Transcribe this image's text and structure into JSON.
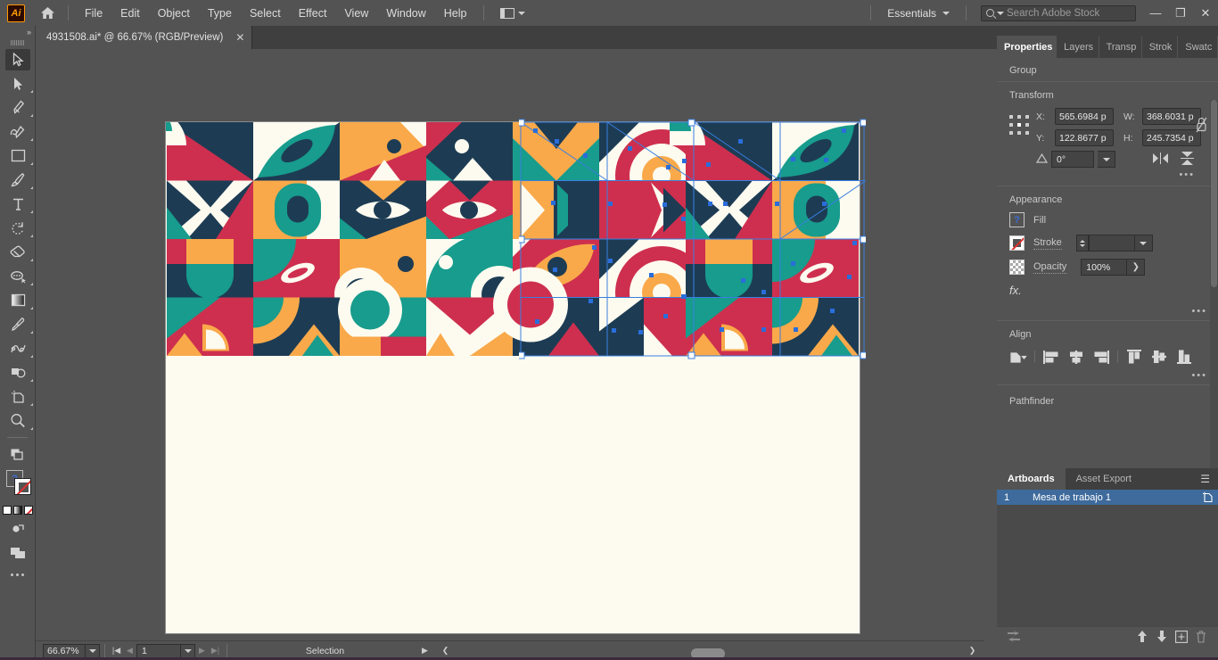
{
  "app": {
    "name": "Adobe Illustrator",
    "logo_text": "Ai"
  },
  "menubar": {
    "items": [
      "File",
      "Edit",
      "Object",
      "Type",
      "Select",
      "Effect",
      "View",
      "Window",
      "Help"
    ],
    "workspace": "Essentials",
    "search_placeholder": "Search Adobe Stock",
    "search_value": "",
    "window_buttons": {
      "minimize": "—",
      "maximize": "❐",
      "close": "✕"
    }
  },
  "document_tab": {
    "title": "4931508.ai* @ 66.67% (RGB/Preview)",
    "close": "✕"
  },
  "toolbar": {
    "collapse": "»",
    "tools": [
      {
        "name": "selection-tool",
        "label": "Selection",
        "selected": true
      },
      {
        "name": "direct-selection-tool",
        "label": "Direct Selection"
      },
      {
        "name": "pen-tool",
        "label": "Pen"
      },
      {
        "name": "curvature-tool",
        "label": "Curvature"
      },
      {
        "name": "rectangle-tool",
        "label": "Rectangle"
      },
      {
        "name": "paintbrush-tool",
        "label": "Paintbrush"
      },
      {
        "name": "type-tool",
        "label": "Type"
      },
      {
        "name": "rotate-tool",
        "label": "Rotate"
      },
      {
        "name": "eraser-tool",
        "label": "Eraser"
      },
      {
        "name": "lasso-tool",
        "label": "Lasso"
      },
      {
        "name": "gradient-tool",
        "label": "Gradient"
      },
      {
        "name": "eyedropper-tool",
        "label": "Eyedropper"
      },
      {
        "name": "blend-tool",
        "label": "Blend"
      },
      {
        "name": "shape-builder-tool",
        "label": "Shape Builder"
      },
      {
        "name": "artboard-tool",
        "label": "Artboard"
      },
      {
        "name": "zoom-tool",
        "label": "Zoom"
      }
    ],
    "fill_label": "?",
    "stroke_label": "None"
  },
  "panel": {
    "tabs": [
      {
        "label": "Properties",
        "active": true
      },
      {
        "label": "Layers",
        "active": false
      },
      {
        "label": "Transp",
        "active": false
      },
      {
        "label": "Strok",
        "active": false
      },
      {
        "label": "Swatc",
        "active": false
      }
    ],
    "selection_type": "Group",
    "transform": {
      "title": "Transform",
      "x_label": "X:",
      "x_value": "565.6984 p",
      "y_label": "Y:",
      "y_value": "122.8677 p",
      "w_label": "W:",
      "w_value": "368.6031 p",
      "h_label": "H:",
      "h_value": "245.7354 p",
      "angle_label": "∠:",
      "angle_value": "0°",
      "more": "•••"
    },
    "appearance": {
      "title": "Appearance",
      "fill_label": "Fill",
      "fill_value": "?",
      "stroke_label": "Stroke",
      "stroke_weight": "",
      "opacity_label": "Opacity",
      "opacity_value": "100%",
      "fx_label": "fx.",
      "more": "•••"
    },
    "align": {
      "title": "Align",
      "more": "•••",
      "buttons": [
        "align-to-selection",
        "align-left",
        "align-horizontal-center",
        "align-right",
        "align-top",
        "align-vertical-center",
        "align-bottom"
      ]
    },
    "pathfinder": {
      "title": "Pathfinder"
    },
    "artboards": {
      "tabs": [
        {
          "label": "Artboards",
          "active": true
        },
        {
          "label": "Asset Export",
          "active": false
        }
      ],
      "menu": "☰",
      "items": [
        {
          "number": "1",
          "name": "Mesa de trabajo 1",
          "selected": true
        }
      ]
    }
  },
  "statusbar": {
    "zoom": "66.67%",
    "page": "1",
    "status_text": "Selection",
    "first": "|◀",
    "prev": "◀",
    "next": "▶",
    "last": "▶|"
  },
  "artwork": {
    "palette": {
      "navy": "#1d3c54",
      "crimson": "#ce2f4e",
      "teal": "#179c8d",
      "orange": "#f9a94a",
      "cream": "#fdfbf0"
    },
    "grid_cols": 8,
    "grid_rows": 4,
    "tile_size": 97,
    "selection": {
      "stroke_color": "#3a7fe0",
      "handle_fill": "#ffffff",
      "anchor_fill": "#2a6ddb"
    }
  }
}
